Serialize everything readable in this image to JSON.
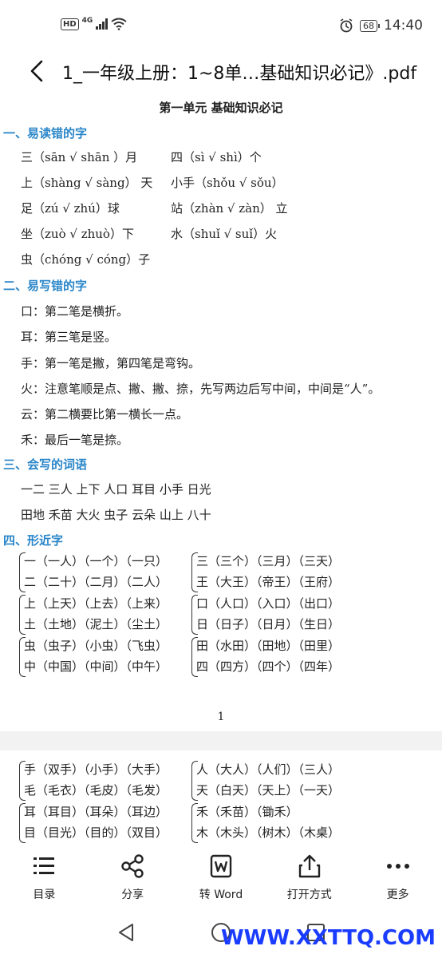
{
  "status": {
    "hd": "HD",
    "net": "4G",
    "battery": "68",
    "time": "14:40"
  },
  "header": {
    "file_title": "1_一年级上册：1~8单…基础知识必记》.pdf"
  },
  "doc": {
    "title": "第一单元  基础知识必记",
    "sections": [
      "一、易读错的字",
      "二、易写错的字",
      "三、会写的词语",
      "四、形近字"
    ],
    "sec1": [
      "三（sān √ shān  ）月",
      "四（sì √ shì）个",
      "上（shàng √ sàng）  天",
      "小手（shǒu √ sǒu）",
      "足（zú √ zhú）球",
      "站（zhàn √ zàn）  立",
      "坐（zuò √ zhuò）下",
      "水（shuǐ √ suǐ）火",
      "虫（chóng √ cóng）子"
    ],
    "sec2": [
      "口：第二笔是横折。",
      "耳：第三笔是竖。",
      "手：第一笔是撇，第四笔是弯钩。",
      "火：注意笔顺是点、撇、撇、捺，先写两边后写中间，中间是“人”。",
      "云：第二横要比第一横长一点。",
      "禾：最后一笔是捺。"
    ],
    "sec3": [
      "一二  三人  上下  人口  耳目  小手  日光",
      "田地  禾苗  大火  虫子  云朵  山上  八十"
    ],
    "sec4": [
      [
        "一（一人）（一个）（一只）",
        "二（二十）（二月）（二人）",
        "三（三个）（三月）（三天）",
        "王（大王）（帝王）（王府）"
      ],
      [
        "上（上天）（上去）（上来）",
        "土（土地）（泥土）（尘土）",
        "口（人口）（入口）（出口）",
        "日（日子）（日月）（生日）"
      ],
      [
        "虫（虫子）（小虫）（飞虫）",
        "中（中国）（中间）（中午）",
        "田（水田）（田地）（田里）",
        "四（四方）（四个）（四年）"
      ]
    ],
    "page_number": "1",
    "next_page": [
      [
        "手（双手）（小手）（大手）",
        "毛（毛衣）（毛皮）（毛发）",
        "人（大人）（人们）（三人）",
        "天（白天）（天上）（一天）"
      ],
      [
        "耳（耳目）（耳朵）（耳边）",
        "目（目光）（目的）（双目）",
        "禾（禾苗）（锄禾）",
        "木（木头）（树木）（木桌）"
      ]
    ]
  },
  "toolbar": [
    "目录",
    "分享",
    "转 Word",
    "打开方式",
    "更多"
  ],
  "watermark": "WWW.XXTTQ.COM"
}
